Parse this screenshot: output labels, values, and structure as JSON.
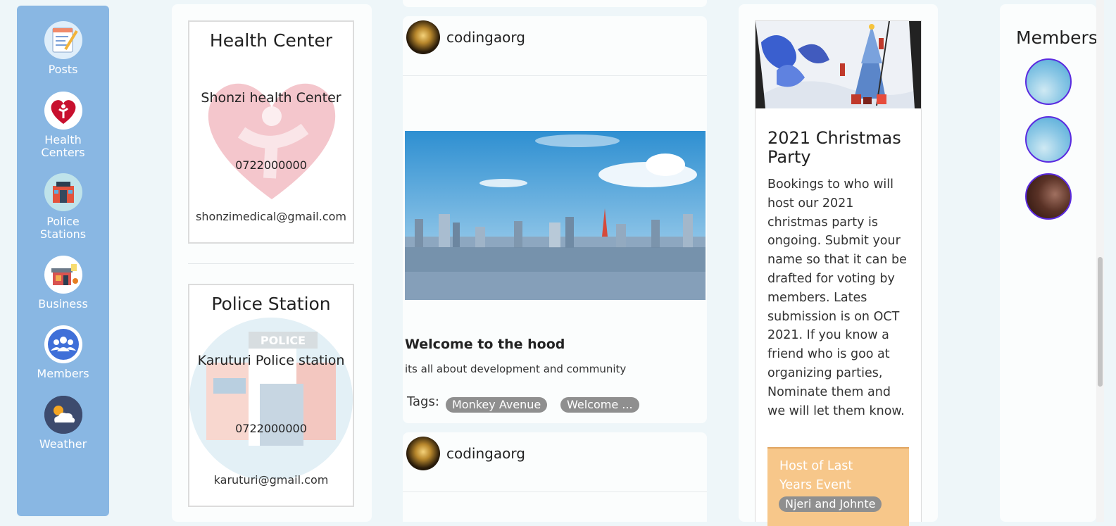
{
  "nav": {
    "items": [
      {
        "label": "Posts",
        "icon": "posts-icon"
      },
      {
        "label": "Health Centers",
        "icon": "heart-icon"
      },
      {
        "label": "Police Stations",
        "icon": "police-station-icon"
      },
      {
        "label": "Business",
        "icon": "shop-icon"
      },
      {
        "label": "Members",
        "icon": "members-icon"
      },
      {
        "label": "Weather",
        "icon": "weather-icon"
      }
    ]
  },
  "health": {
    "heading": "Health Center",
    "name": "Shonzi health Center",
    "phone": "0722000000",
    "email": "shonzimedical@gmail.com"
  },
  "police": {
    "heading": "Police Station",
    "sign": "POLICE",
    "name": "Karuturi Police station",
    "phone": "0722000000",
    "email": "karuturi@gmail.com"
  },
  "posts": [
    {
      "author": "codingaorg",
      "title": "Welcome to the hood",
      "body": "its all about development and community",
      "tags_label": "Tags:",
      "tags": [
        "Monkey Avenue",
        "Welcome ..."
      ]
    },
    {
      "author": "codingaorg"
    }
  ],
  "event": {
    "title": "2021 Christmas Party",
    "description": "Bookings to who will host our 2021 christmas party is ongoing. Submit your name so that it can be drafted for voting by members. Lates submission is on OCT 2021. If you know a friend who is goo at organizing parties, Nominate them and we will let them know.",
    "host_label": "Host of Last Years Event",
    "host_name": "Njeri and Johnte"
  },
  "members": {
    "heading": "Members"
  },
  "colors": {
    "nav": "#89b7e3",
    "page": "#eef6f9",
    "accent_border": "#5b2be0",
    "host_box": "#f7c78a"
  }
}
